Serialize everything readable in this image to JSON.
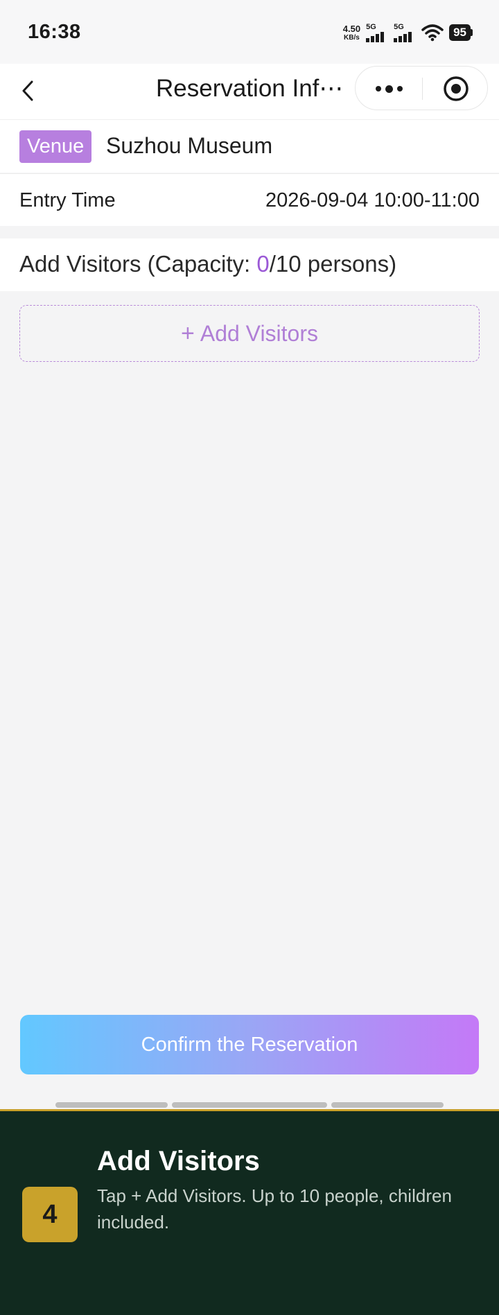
{
  "status_bar": {
    "time": "16:38",
    "net_speed_value": "4.50",
    "net_speed_unit": "KB/s",
    "signal_1_label": "5G",
    "signal_2_label": "5G",
    "battery": "95"
  },
  "nav": {
    "title": "Reservation Inf⋯"
  },
  "venue": {
    "tag": "Venue",
    "name": "Suzhou Museum"
  },
  "entry": {
    "label": "Entry Time",
    "value": "2026-09-04 10:00-11:00"
  },
  "visitors": {
    "title_prefix": "Add Visitors (Capacity: ",
    "count": "0",
    "title_suffix": "/10 persons)",
    "add_button_plus": "+",
    "add_button_label": "Add Visitors"
  },
  "confirm": {
    "label": "Confirm the Reservation"
  },
  "tutorial": {
    "step_number": "4",
    "title": "Add Visitors",
    "description": "Tap + Add Visitors. Up to 10 people, children included."
  },
  "colors": {
    "accent_purple": "#9b59d6",
    "venue_tag": "#b77fdf",
    "tutorial_bg": "#112a1f",
    "tutorial_badge": "#c9a22b"
  }
}
